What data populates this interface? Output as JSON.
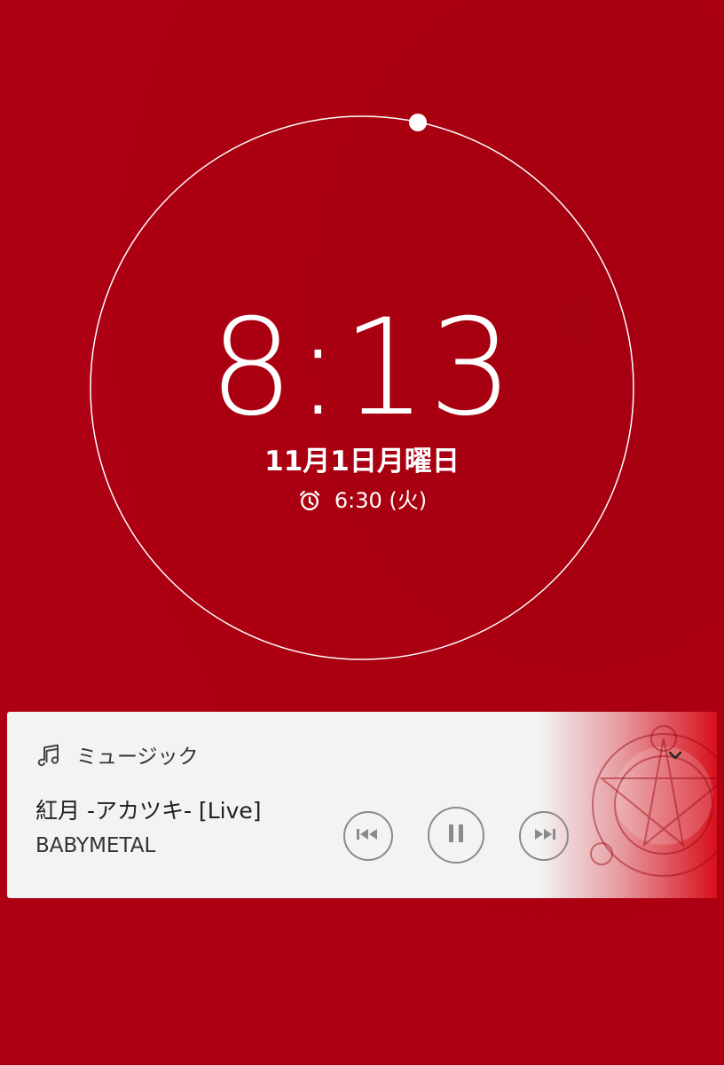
{
  "lockscreen": {
    "time": "8:13",
    "date": "11月1日月曜日",
    "alarm": {
      "icon": "alarm-clock-icon",
      "text": "6:30 (火)"
    }
  },
  "media": {
    "app_icon": "music-note-icon",
    "app_name": "ミュージック",
    "title": "紅月 -アカツキ- [Live]",
    "artist": "BABYMETAL",
    "controls": {
      "previous": "skip-previous-icon",
      "pause": "pause-icon",
      "next": "skip-next-icon",
      "collapse": "chevron-down-icon"
    }
  },
  "colors": {
    "background": "#ad0012",
    "card": "#f3f3f3",
    "ring": "#ffffff",
    "text_dark": "#212121"
  }
}
